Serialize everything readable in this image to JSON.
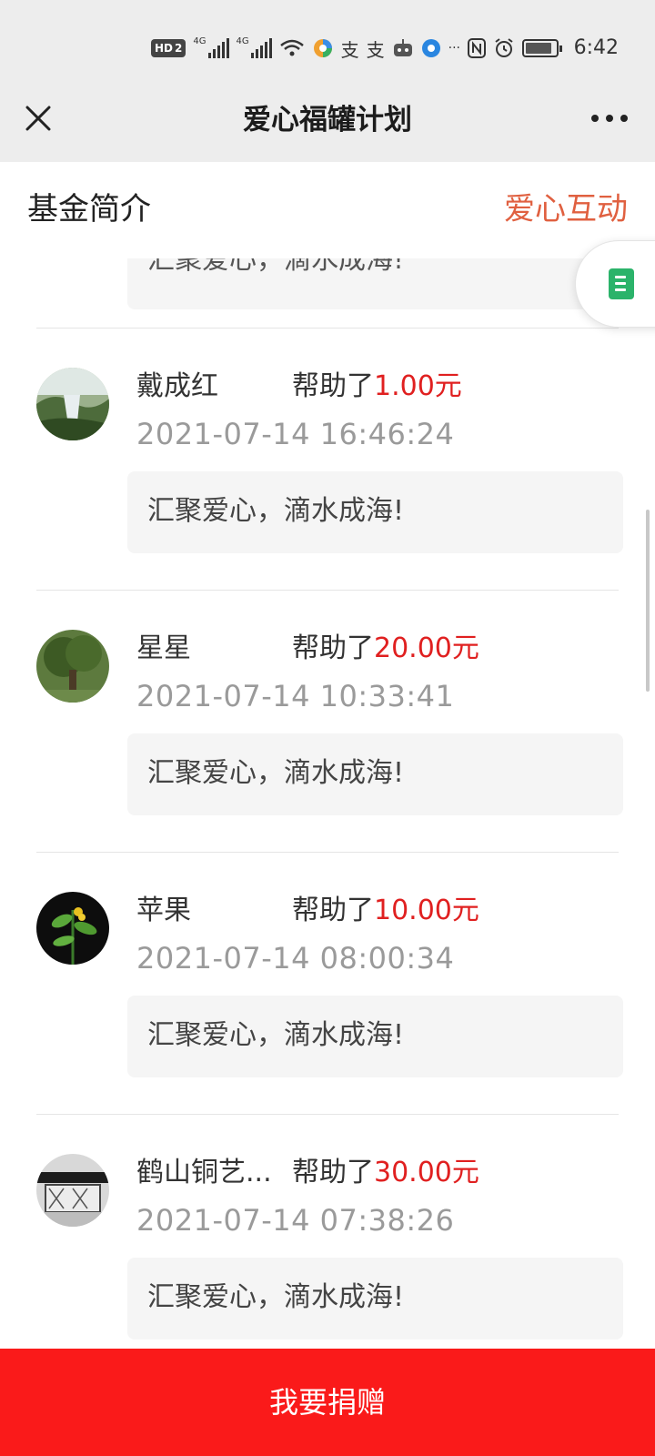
{
  "status_bar": {
    "time": "6:42",
    "hd_badge": "HD",
    "hd_num": "2",
    "net1": "4G",
    "net2": "4G",
    "more": "···"
  },
  "nav": {
    "title": "爱心福罐计划"
  },
  "tabs": {
    "left": "基金简介",
    "right": "爱心互动"
  },
  "partial_item": {
    "message": "汇聚爱心，滴水成海!"
  },
  "items": [
    {
      "name": "戴成红",
      "helped": "帮助了",
      "amount": "1.00元",
      "time": "2021-07-14 16:46:24",
      "message": "汇聚爱心，滴水成海!"
    },
    {
      "name": "星星",
      "helped": "帮助了",
      "amount": "20.00元",
      "time": "2021-07-14 10:33:41",
      "message": "汇聚爱心，滴水成海!"
    },
    {
      "name": "苹果",
      "helped": "帮助了",
      "amount": "10.00元",
      "time": "2021-07-14 08:00:34",
      "message": "汇聚爱心，滴水成海!"
    },
    {
      "name": "鹤山铜艺...",
      "helped": "帮助了",
      "amount": "30.00元",
      "time": "2021-07-14 07:38:26",
      "message": "汇聚爱心，滴水成海!"
    }
  ],
  "donate_button": "我要捐赠",
  "colors": {
    "accent_red": "#e02020",
    "tab_orange": "#e06040",
    "donate_bg": "#fa1a1a"
  }
}
